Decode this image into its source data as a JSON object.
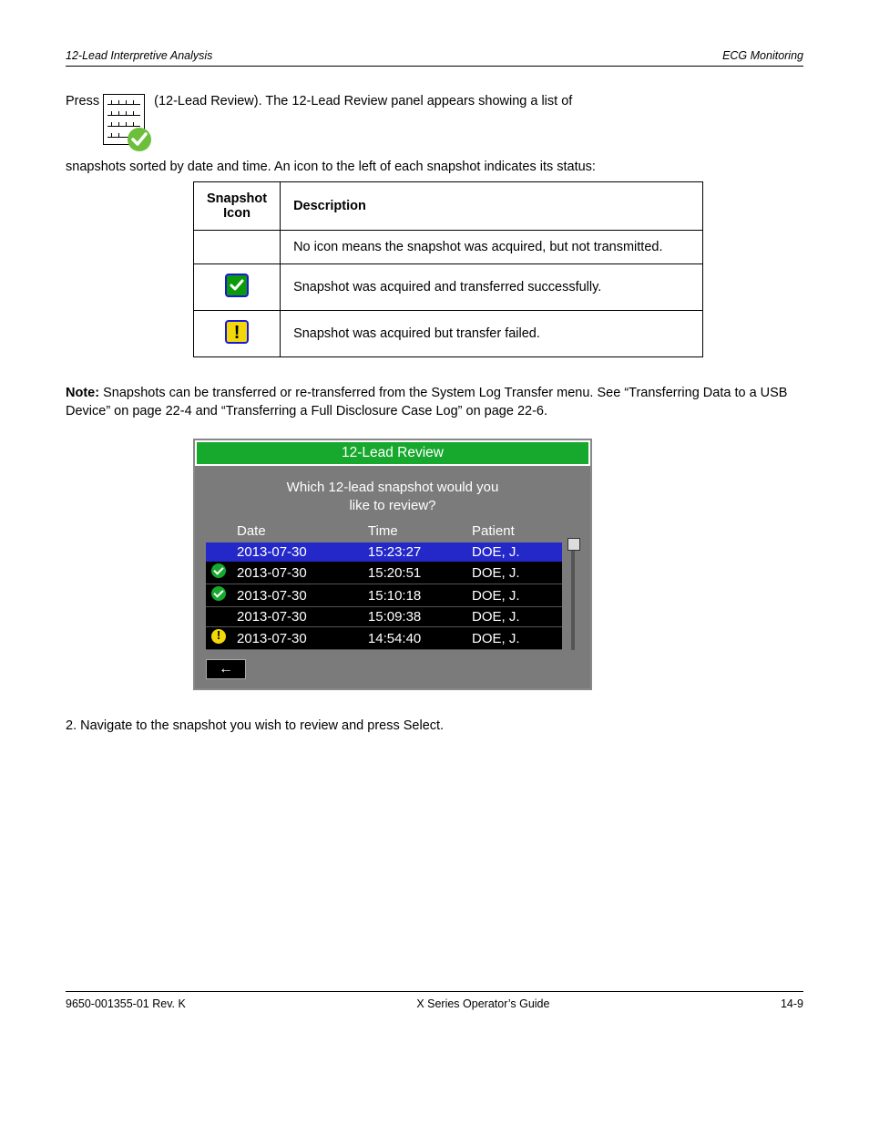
{
  "header": {
    "left": "12-Lead Interpretive Analysis",
    "right": "ECG Monitoring"
  },
  "pressline": {
    "prefix": "Press ",
    "suffix": " (12-Lead Review). The 12-Lead Review panel appears showing a list of"
  },
  "line2": "snapshots sorted by date and time. An icon to the left of each snapshot indicates its status:",
  "iconTable": {
    "h1": "Snapshot Icon",
    "h2": "Description",
    "rows": [
      {
        "icon": "none",
        "desc": "No icon means the snapshot was acquired, but not transmitted."
      },
      {
        "icon": "check",
        "desc": "Snapshot was acquired and transferred successfully."
      },
      {
        "icon": "warn",
        "desc": "Snapshot was acquired but transfer failed."
      }
    ]
  },
  "note": {
    "label": "Note:",
    "text": "Snapshots can be transferred or re-transferred from the System Log Transfer menu. See “Transferring Data to a USB Device” on page 22-4 and “Transferring a Full Disclosure Case Log” on page 22-6."
  },
  "device": {
    "title": "12-Lead Review",
    "prompt_l1": "Which 12-lead snapshot would you",
    "prompt_l2": "like to review?",
    "columns": {
      "date": "Date",
      "time": "Time",
      "patient": "Patient"
    },
    "rows": [
      {
        "icon": "",
        "date": "2013-07-30",
        "time": "15:23:27",
        "patient": "DOE, J.",
        "selected": true
      },
      {
        "icon": "check",
        "date": "2013-07-30",
        "time": "15:20:51",
        "patient": "DOE, J.",
        "selected": false
      },
      {
        "icon": "check",
        "date": "2013-07-30",
        "time": "15:10:18",
        "patient": "DOE, J.",
        "selected": false
      },
      {
        "icon": "",
        "date": "2013-07-30",
        "time": "15:09:38",
        "patient": "DOE, J.",
        "selected": false
      },
      {
        "icon": "warn",
        "date": "2013-07-30",
        "time": "14:54:40",
        "patient": "DOE, J.",
        "selected": false
      }
    ],
    "back_label": "←"
  },
  "step2": "2. Navigate to the snapshot you wish to review and press Select.",
  "footer": {
    "left": "9650-001355-01 Rev. K",
    "center": "X Series Operator’s Guide",
    "right": "14-9"
  }
}
